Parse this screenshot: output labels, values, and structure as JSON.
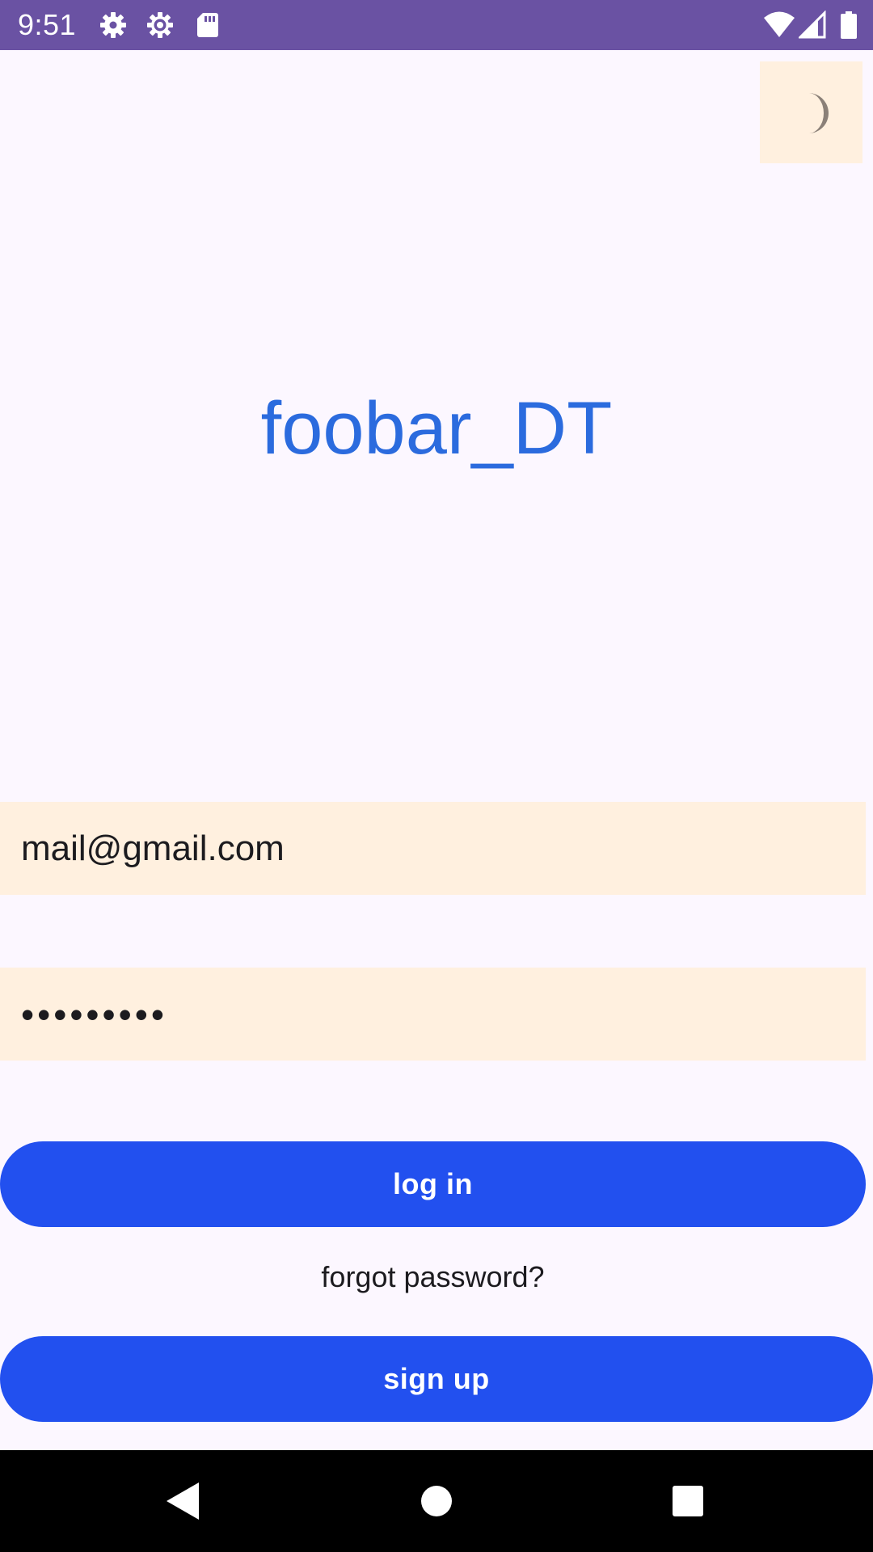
{
  "status_bar": {
    "time": "9:51",
    "left_icons": [
      "settings-gear-filled-icon",
      "settings-gear-outline-icon",
      "sd-card-icon"
    ],
    "right_icons": [
      "wifi-icon",
      "cellular-signal-icon",
      "battery-icon"
    ],
    "background_color": "#6a52a3"
  },
  "theme_toggle": {
    "icon": "moon-icon",
    "background_color": "#fff0df"
  },
  "app": {
    "title": "foobar_DT",
    "title_color": "#2b6bde"
  },
  "login_form": {
    "email_value": "mail@gmail.com",
    "password_value": "•••••••••",
    "field_background_color": "#fff0df",
    "login_label": "log in",
    "forgot_password_label": "forgot password?",
    "signup_label": "sign up",
    "button_color": "#2250ef"
  },
  "nav_bar": {
    "icons": [
      "back-icon",
      "home-icon",
      "recents-icon"
    ]
  }
}
